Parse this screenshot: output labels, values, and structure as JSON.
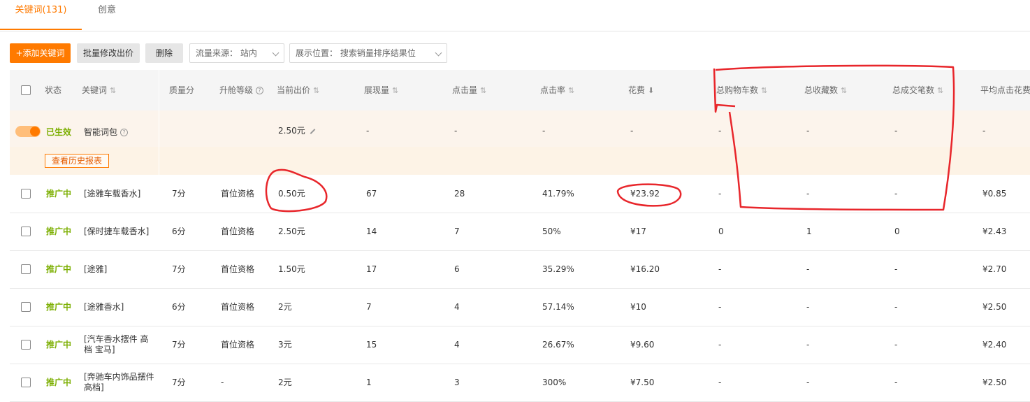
{
  "tabs": [
    {
      "label": "关键词(131)",
      "active": true
    },
    {
      "label": "创意",
      "active": false
    }
  ],
  "toolbar": {
    "add_keyword": "+添加关键词",
    "batch_bid": "批量修改出价",
    "delete": "删除",
    "traffic_source": "流量来源： 站内",
    "display_position": "展示位置： 搜索销量排序结果位"
  },
  "table": {
    "headers": {
      "status": "状态",
      "keyword": "关键词",
      "quality": "质量分",
      "level": "升舱等级",
      "bid": "当前出价",
      "impressions": "展现量",
      "clicks": "点击量",
      "ctr": "点击率",
      "cost": "花费",
      "cart": "总购物车数",
      "fav": "总收藏数",
      "deals": "总成交笔数",
      "avg_cpc": "平均点击花费"
    },
    "smart_row": {
      "status": "已生效",
      "keyword": "智能词包",
      "bid": "2.50元",
      "impressions": "-",
      "clicks": "-",
      "ctr": "-",
      "cost": "-",
      "cart": "-",
      "fav": "-",
      "deals": "-",
      "avg_cpc": "-",
      "history_button": "查看历史报表"
    },
    "rows": [
      {
        "status": "推广中",
        "keyword": "[途雅车载香水]",
        "quality": "7分",
        "level": "首位资格",
        "bid": "0.50元",
        "impressions": "67",
        "clicks": "28",
        "ctr": "41.79%",
        "cost": "¥23.92",
        "cart": "-",
        "fav": "-",
        "deals": "-",
        "avg_cpc": "¥0.85"
      },
      {
        "status": "推广中",
        "keyword": "[保时捷车载香水]",
        "quality": "6分",
        "level": "首位资格",
        "bid": "2.50元",
        "impressions": "14",
        "clicks": "7",
        "ctr": "50%",
        "cost": "¥17",
        "cart": "0",
        "fav": "1",
        "deals": "0",
        "avg_cpc": "¥2.43"
      },
      {
        "status": "推广中",
        "keyword": "[途雅]",
        "quality": "7分",
        "level": "首位资格",
        "bid": "1.50元",
        "impressions": "17",
        "clicks": "6",
        "ctr": "35.29%",
        "cost": "¥16.20",
        "cart": "-",
        "fav": "-",
        "deals": "-",
        "avg_cpc": "¥2.70"
      },
      {
        "status": "推广中",
        "keyword": "[途雅香水]",
        "quality": "6分",
        "level": "首位资格",
        "bid": "2元",
        "impressions": "7",
        "clicks": "4",
        "ctr": "57.14%",
        "cost": "¥10",
        "cart": "-",
        "fav": "-",
        "deals": "-",
        "avg_cpc": "¥2.50"
      },
      {
        "status": "推广中",
        "keyword": "[汽车香水摆件 高档 宝马]",
        "quality": "7分",
        "level": "首位资格",
        "bid": "3元",
        "impressions": "15",
        "clicks": "4",
        "ctr": "26.67%",
        "cost": "¥9.60",
        "cart": "-",
        "fav": "-",
        "deals": "-",
        "avg_cpc": "¥2.40"
      },
      {
        "status": "推广中",
        "keyword": "[奔驰车内饰品摆件 高档]",
        "quality": "7分",
        "level": "-",
        "bid": "2元",
        "impressions": "1",
        "clicks": "3",
        "ctr": "300%",
        "cost": "¥7.50",
        "cart": "-",
        "fav": "-",
        "deals": "-",
        "avg_cpc": "¥2.50"
      }
    ]
  },
  "annotation_color": "#e8262b",
  "accent_color": "#ff7a00"
}
